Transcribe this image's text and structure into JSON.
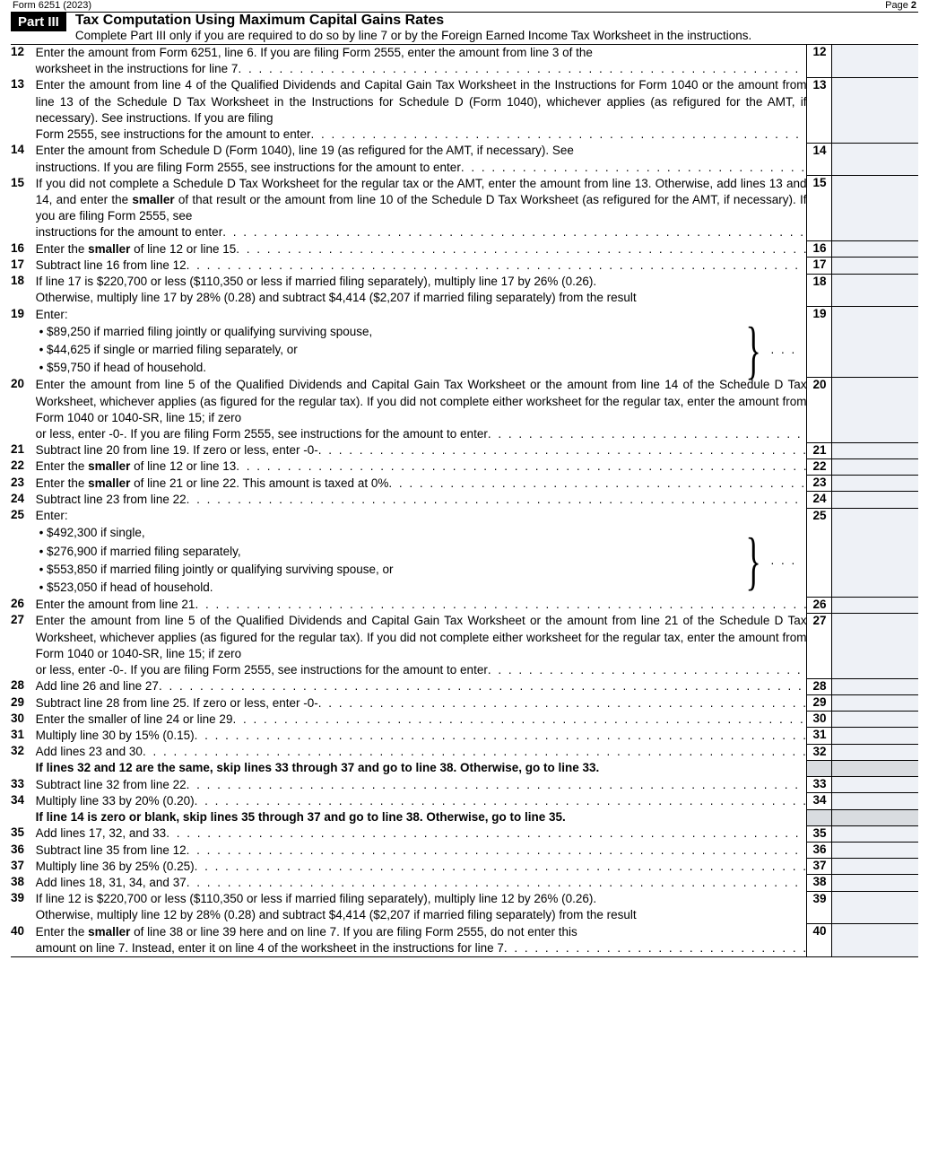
{
  "header": {
    "form_ref": "Form 6251 (2023)",
    "page": "Page 2",
    "part_label": "Part III",
    "part_title": "Tax Computation Using Maximum Capital Gains Rates",
    "part_sub": "Complete Part III only if you are required to do so by line 7 or by the Foreign Earned Income Tax Worksheet in the instructions."
  },
  "lines": {
    "l12": {
      "num": "12",
      "pre": "Enter the amount from Form 6251, line 6. If you are filing Form 2555, enter the amount from line 3 of the",
      "last": "worksheet in the instructions for line 7"
    },
    "l13": {
      "num": "13",
      "pre": "Enter the amount from line 4 of the Qualified Dividends and Capital Gain Tax Worksheet in the Instructions for Form 1040 or the amount from line 13 of the Schedule D Tax Worksheet in the Instructions for Schedule D (Form 1040), whichever applies (as refigured for the AMT, if necessary). See instructions. If you are filing",
      "last": "Form 2555, see instructions for the amount to enter"
    },
    "l14": {
      "num": "14",
      "pre": "Enter the amount from Schedule D (Form 1040), line 19 (as refigured for the AMT, if necessary). See",
      "last": "instructions. If you are filing Form 2555, see instructions for the amount to enter"
    },
    "l15": {
      "num": "15",
      "pre_a": "If you did not complete a Schedule D Tax Worksheet for the regular tax or the AMT, enter the amount from line 13. Otherwise, add lines 13 and 14, and enter the ",
      "bold_a": "smaller",
      "pre_b": " of that result or the amount from line 10 of the Schedule D Tax Worksheet (as refigured for the AMT, if necessary). If you are filing Form 2555, see",
      "last": "instructions for the amount to enter"
    },
    "l16": {
      "num": "16",
      "last_a": "Enter the ",
      "bold": "smaller",
      "last_b": " of line 12 or line 15"
    },
    "l17": {
      "num": "17",
      "last": "Subtract line 16 from line 12"
    },
    "l18": {
      "num": "18",
      "pre": "If line 17 is $220,700 or less ($110,350 or less if married filing separately), multiply line 17 by 26% (0.26).",
      "last": "Otherwise, multiply line 17 by 28% (0.28) and subtract $4,414 ($2,207 if married filing separately) from the result"
    },
    "l19": {
      "num": "19",
      "intro": "Enter:",
      "b1": "• $89,250 if married filing jointly or qualifying surviving spouse,",
      "b2": "• $44,625 if single or married filing separately, or",
      "b3": "• $59,750 if head of household."
    },
    "l20": {
      "num": "20",
      "pre": "Enter the amount from line 5 of the Qualified Dividends and Capital Gain Tax Worksheet or the amount from line 14 of the Schedule D Tax Worksheet, whichever applies (as figured for the regular tax). If you did not complete either worksheet for the regular tax, enter the amount from Form 1040 or 1040-SR, line 15; if zero",
      "last": "or less, enter -0-. If you are filing Form 2555, see instructions for the amount to enter"
    },
    "l21": {
      "num": "21",
      "last": "Subtract line 20 from line 19. If zero or less, enter -0-"
    },
    "l22": {
      "num": "22",
      "last_a": "Enter the ",
      "bold": "smaller",
      "last_b": " of line 12 or line 13"
    },
    "l23": {
      "num": "23",
      "last_a": "Enter the ",
      "bold": "smaller",
      "last_b": " of line 21 or line 22. This amount is taxed at 0%"
    },
    "l24": {
      "num": "24",
      "last": "Subtract line 23 from line 22"
    },
    "l25": {
      "num": "25",
      "intro": "Enter:",
      "b1": "• $492,300 if single,",
      "b2": "• $276,900 if married filing separately,",
      "b3": "• $553,850 if married filing jointly or qualifying surviving spouse, or",
      "b4": "• $523,050 if head of household."
    },
    "l26": {
      "num": "26",
      "last": "Enter the amount from line 21"
    },
    "l27": {
      "num": "27",
      "pre": "Enter the amount from line 5 of the Qualified Dividends and Capital Gain Tax Worksheet or the amount from line 21 of the Schedule D Tax Worksheet, whichever applies (as figured for the regular tax). If you did not complete either worksheet for the regular tax, enter the amount from Form 1040 or 1040-SR, line 15; if zero",
      "last": "or less, enter -0-. If you are filing Form 2555, see instructions for the amount to enter"
    },
    "l28": {
      "num": "28",
      "last": "Add line 26 and line 27"
    },
    "l29": {
      "num": "29",
      "last": "Subtract line 28 from line 25. If zero or less, enter -0-"
    },
    "l30": {
      "num": "30",
      "last": "Enter the smaller of line 24 or line 29"
    },
    "l31": {
      "num": "31",
      "last": "Multiply line 30 by 15% (0.15)"
    },
    "l32": {
      "num": "32",
      "last": "Add lines 23 and 30"
    },
    "n32": {
      "note": "If lines 32 and 12 are the same, skip lines 33 through 37 and go to line 38. Otherwise, go to line 33."
    },
    "l33": {
      "num": "33",
      "last": "Subtract line 32 from line 22"
    },
    "l34": {
      "num": "34",
      "last": "Multiply line 33 by 20% (0.20)"
    },
    "n34": {
      "note": "If line 14 is zero or blank, skip lines 35 through 37 and go to line 38. Otherwise, go to line 35."
    },
    "l35": {
      "num": "35",
      "last": "Add lines 17, 32, and 33"
    },
    "l36": {
      "num": "36",
      "last": "Subtract line 35 from line 12"
    },
    "l37": {
      "num": "37",
      "last": "Multiply line 36 by 25% (0.25)"
    },
    "l38": {
      "num": "38",
      "last": "Add lines 18, 31, 34, and 37"
    },
    "l39": {
      "num": "39",
      "pre": "If line 12 is $220,700 or less ($110,350 or less if married filing separately), multiply line 12 by 26% (0.26).",
      "last": "Otherwise, multiply line 12 by 28% (0.28) and subtract $4,414 ($2,207 if married filing separately) from the result"
    },
    "l40": {
      "num": "40",
      "pre_a": "Enter the ",
      "bold": "smaller",
      "pre_b": " of line 38 or line 39 here and on line 7. If you are filing Form 2555, do not enter this",
      "last": "amount on line 7. Instead, enter it on line 4 of the worksheet in the instructions for line 7"
    }
  }
}
